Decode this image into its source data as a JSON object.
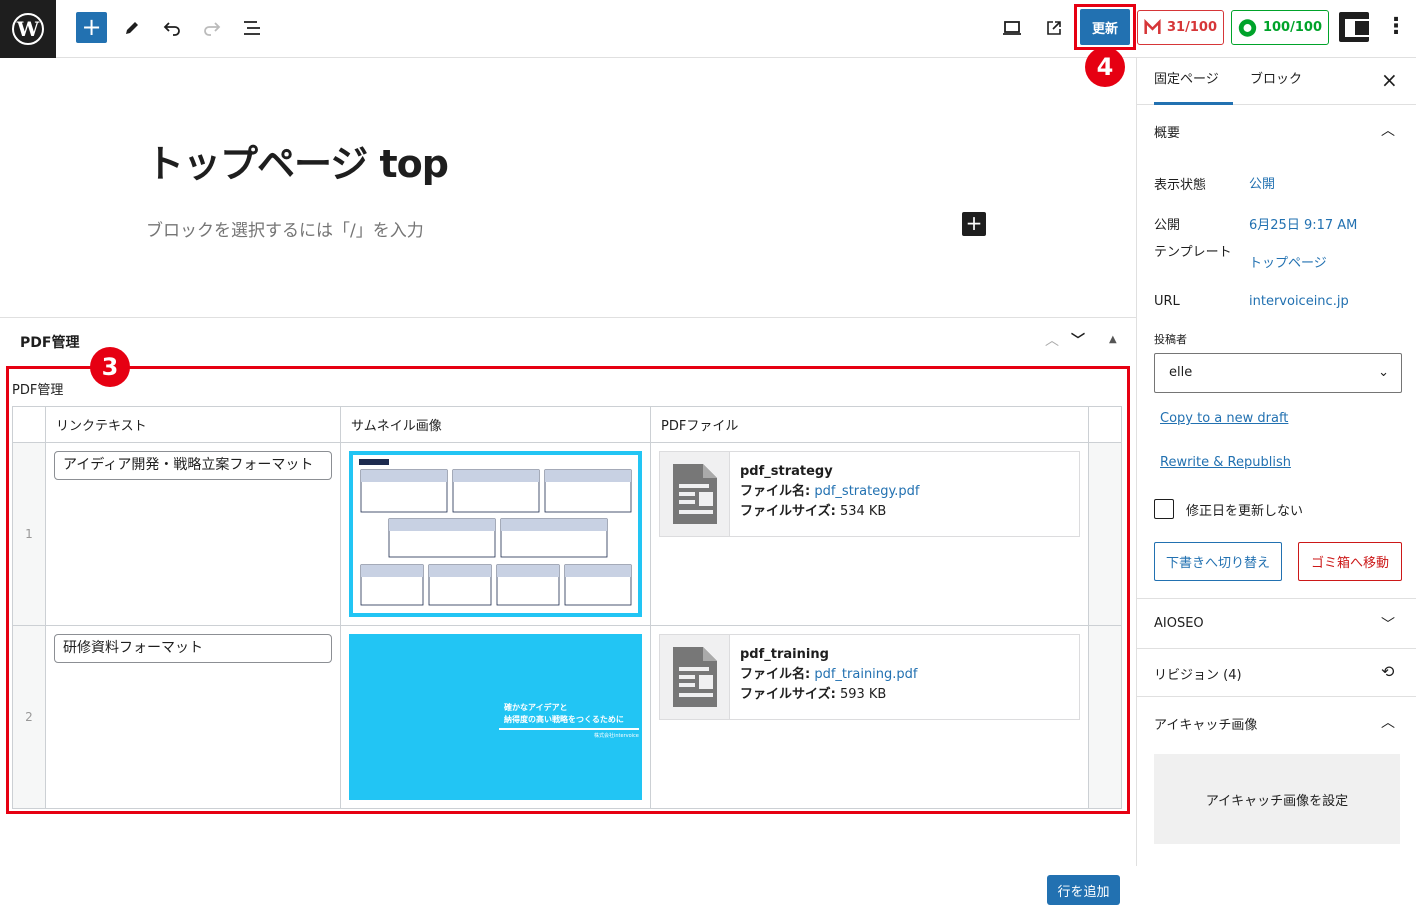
{
  "toolbar": {
    "update_label": "更新",
    "score_red": "31/100",
    "score_green": "100/100",
    "annotation_4": "4"
  },
  "editor": {
    "title": "トップページ top",
    "placeholder": "ブロックを選択するには「/」を入力"
  },
  "metabox": {
    "header": "PDF管理",
    "field_label": "PDF管理",
    "annotation_3": "3",
    "columns": [
      "リンクテキスト",
      "サムネイル画像",
      "PDFファイル"
    ],
    "rows": [
      {
        "order": "1",
        "link_text": "アイディア開発・戦略立案フォーマット",
        "file_title": "pdf_strategy",
        "file_name_label": "ファイル名:",
        "file_name": "pdf_strategy.pdf",
        "file_size_label": "ファイルサイズ:",
        "file_size": "534 KB"
      },
      {
        "order": "2",
        "link_text": "研修資料フォーマット",
        "file_title": "pdf_training",
        "file_name_label": "ファイル名:",
        "file_name": "pdf_training.pdf",
        "file_size_label": "ファイルサイズ:",
        "file_size": "593 KB",
        "thumb_line1": "確かなアイデアと",
        "thumb_line2": "納得度の高い戦略をつくるために",
        "thumb_line3": "株式会社intervoice"
      }
    ],
    "add_row_label": "行を追加"
  },
  "sidebar": {
    "tab_page": "固定ページ",
    "tab_block": "ブロック",
    "summary_header": "概要",
    "visibility_label": "表示状態",
    "visibility_value": "公開",
    "publish_label": "公開",
    "publish_value": "6月25日 9:17 AM",
    "template_label": "テンプレート",
    "template_value": "トップページ",
    "url_label": "URL",
    "url_value": "intervoiceinc.jp",
    "author_label": "投稿者",
    "author_value": "elle",
    "copy_draft": "Copy to a new draft",
    "rewrite_republish": "Rewrite & Republish",
    "no_update_date": "修正日を更新しない",
    "switch_draft": "下書きへ切り替え",
    "move_trash": "ゴミ箱へ移動",
    "aioseo": "AIOSEO",
    "revisions": "リビジョン (4)",
    "featured_header": "アイキャッチ画像",
    "featured_set": "アイキャッチ画像を設定"
  }
}
